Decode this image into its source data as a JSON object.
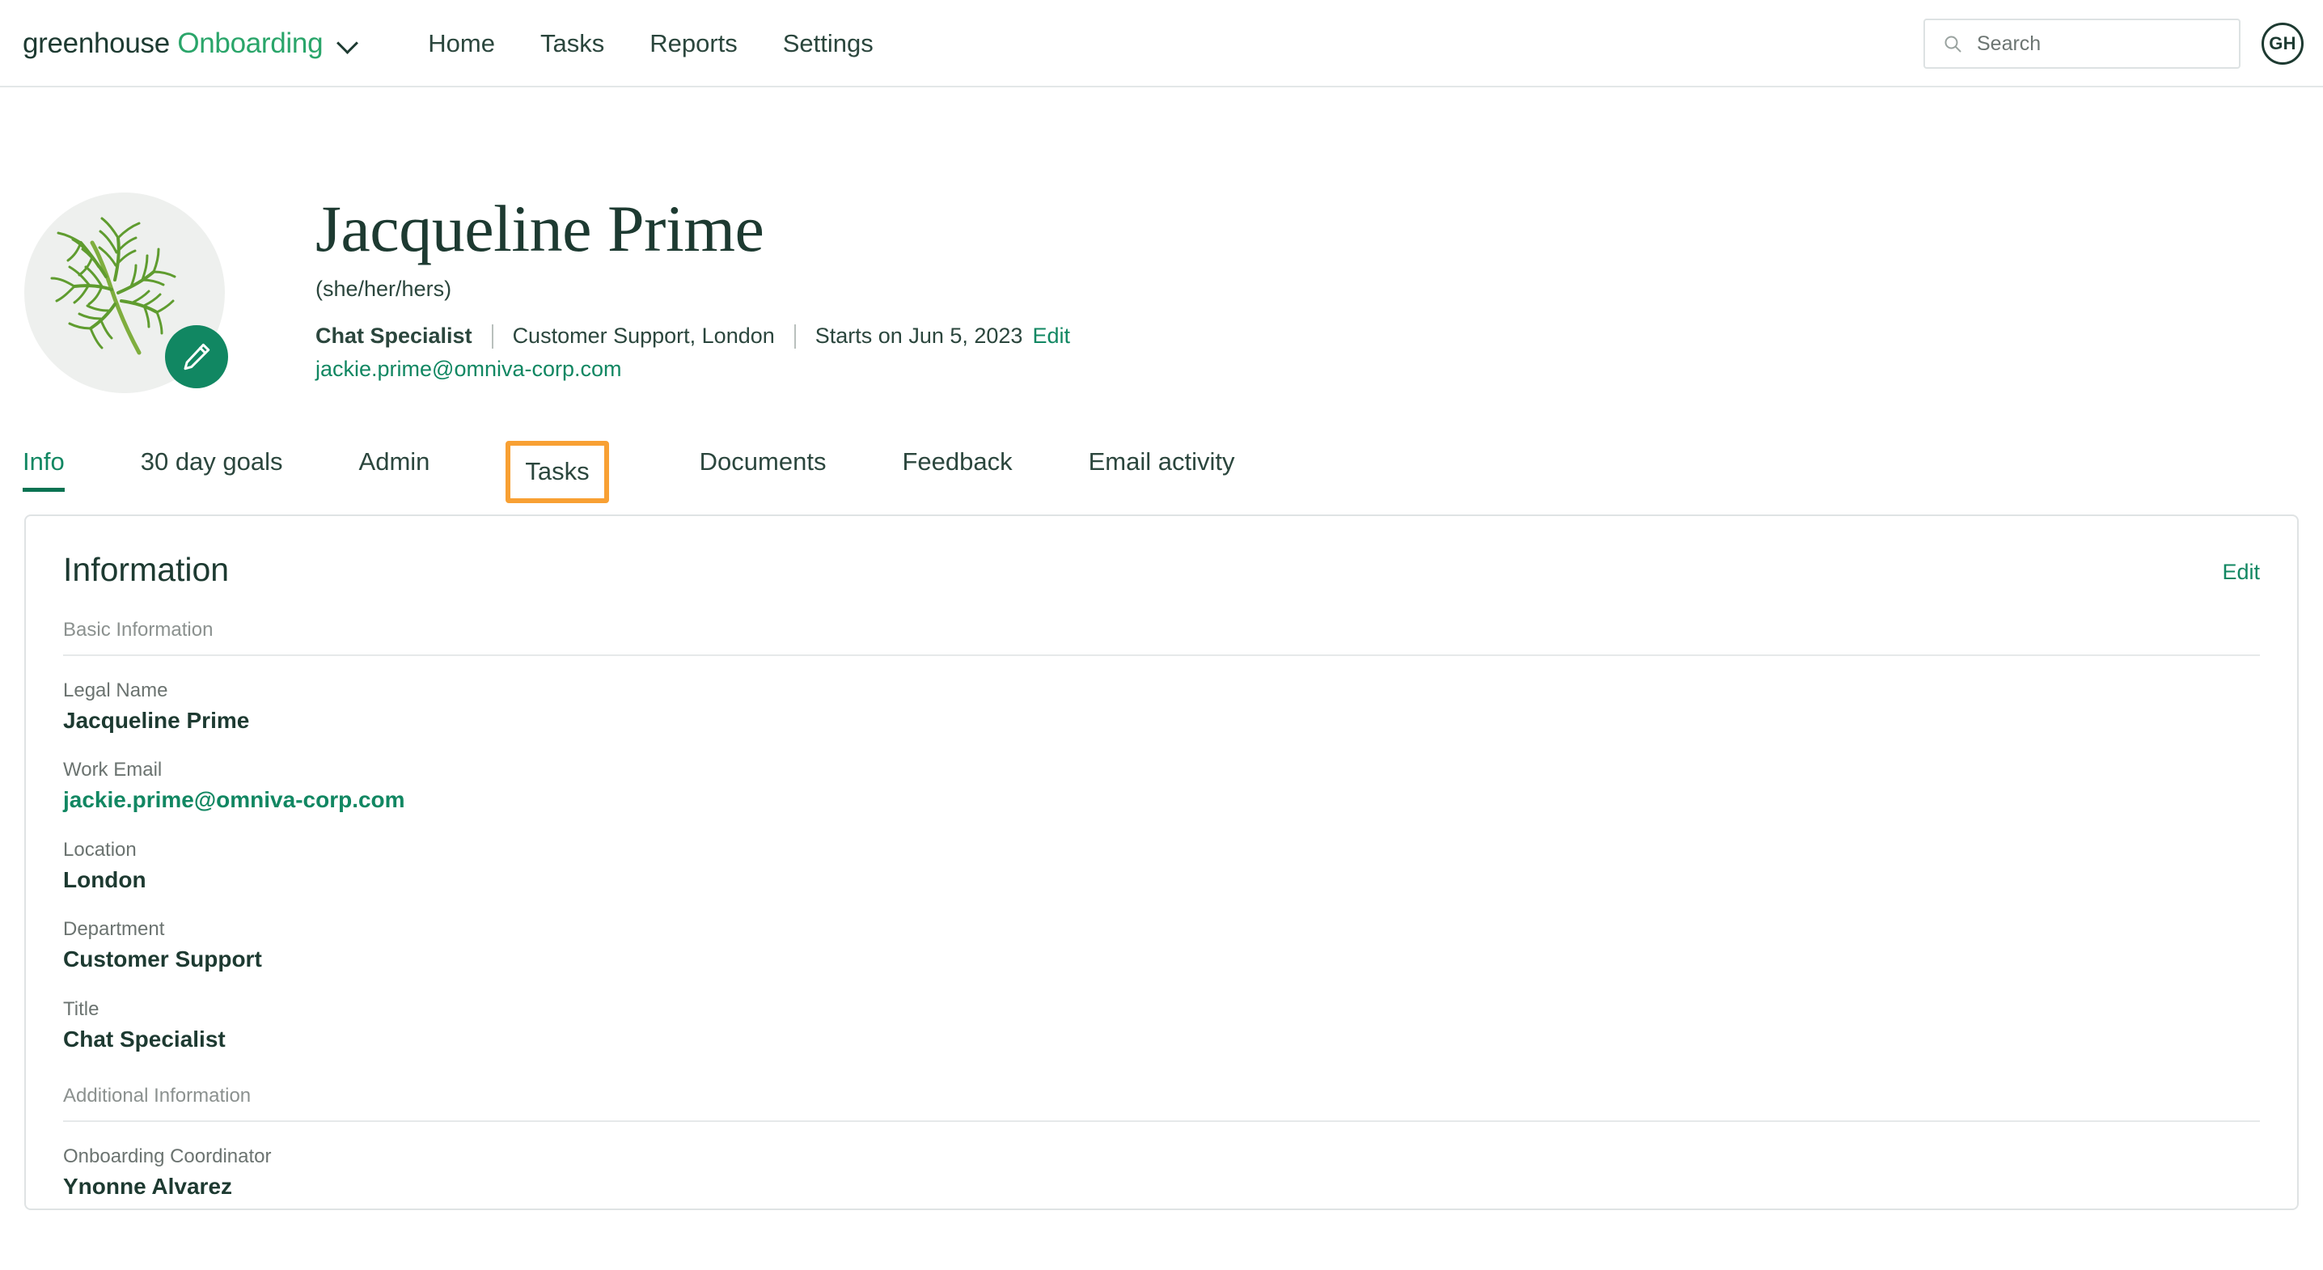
{
  "brand": {
    "word_dark": "greenhouse",
    "word_green": "Onboarding",
    "caret_icon": "chevron-down-icon"
  },
  "nav": {
    "items": [
      {
        "label": "Home"
      },
      {
        "label": "Tasks"
      },
      {
        "label": "Reports"
      },
      {
        "label": "Settings"
      }
    ]
  },
  "search": {
    "placeholder": "Search",
    "value": "",
    "icon": "search-icon"
  },
  "account": {
    "initials": "GH"
  },
  "profile": {
    "avatar_icon": "dill-sprig-avatar",
    "edit_avatar_icon": "pencil-icon",
    "name": "Jacqueline Prime",
    "pronouns": "(she/her/hers)",
    "title": "Chat Specialist",
    "department_location": "Customer Support, London",
    "start_date": "Starts on Jun 5, 2023",
    "edit_label": "Edit",
    "email": "jackie.prime@omniva-corp.com"
  },
  "tabs": [
    {
      "label": "Info",
      "state": "active"
    },
    {
      "label": "30 day goals",
      "state": "default"
    },
    {
      "label": "Admin",
      "state": "default"
    },
    {
      "label": "Tasks",
      "state": "highlighted"
    },
    {
      "label": "Documents",
      "state": "default"
    },
    {
      "label": "Feedback",
      "state": "default"
    },
    {
      "label": "Email activity",
      "state": "default"
    }
  ],
  "info_card": {
    "title": "Information",
    "edit_label": "Edit",
    "sections": [
      {
        "label": "Basic Information",
        "fields": [
          {
            "label": "Legal Name",
            "value": "Jacqueline Prime",
            "link": false
          },
          {
            "label": "Work Email",
            "value": "jackie.prime@omniva-corp.com",
            "link": true
          },
          {
            "label": "Location",
            "value": "London",
            "link": false
          },
          {
            "label": "Department",
            "value": "Customer Support",
            "link": false
          },
          {
            "label": "Title",
            "value": "Chat Specialist",
            "link": false
          }
        ]
      },
      {
        "label": "Additional Information",
        "fields": [
          {
            "label": "Onboarding Coordinator",
            "value": "Ynonne Alvarez",
            "link": false
          }
        ]
      }
    ]
  },
  "colors": {
    "brand_green": "#2aa56a",
    "accent_green": "#118762",
    "dark_green": "#1d3a31",
    "highlight_orange": "#f8a033",
    "border_gray": "#dfe3e4"
  }
}
